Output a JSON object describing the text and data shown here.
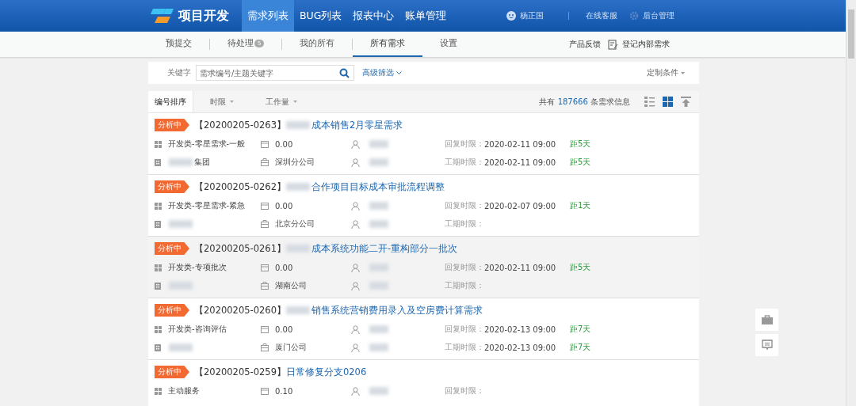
{
  "header": {
    "logo_text": "项目开发",
    "nav": [
      {
        "label": "需求列表",
        "selected": true
      },
      {
        "label": "BUG列表",
        "selected": false
      },
      {
        "label": "报表中心",
        "selected": false
      },
      {
        "label": "账单管理",
        "selected": false
      }
    ],
    "user": "杨正国",
    "links": [
      "在线客服",
      "后台管理"
    ]
  },
  "subnav": {
    "tabs": [
      {
        "label": "预提交",
        "selected": false
      },
      {
        "label": "待处理",
        "badge": "5",
        "selected": false
      },
      {
        "label": "我的所有",
        "selected": false
      },
      {
        "label": "所有需求",
        "selected": true
      },
      {
        "label": "设置",
        "selected": false
      }
    ],
    "feedback": "产品反馈",
    "register": "登记内部需求"
  },
  "filter": {
    "label": "关键字",
    "placeholder": "需求编号/主题关键字",
    "advanced": "高级筛选",
    "custom": "定制条件"
  },
  "sortbar": {
    "sorts": [
      {
        "label": "编号排序",
        "selected": true,
        "caret": false
      },
      {
        "label": "时限",
        "selected": false,
        "caret": true
      },
      {
        "label": "工作量",
        "selected": false,
        "caret": true
      }
    ],
    "total_prefix": "共有",
    "total": "187666",
    "total_suffix": "条需求信息"
  },
  "rows": [
    {
      "status": "分析中",
      "code": "【20200205-0263】",
      "title": "成本销售2月零星需求",
      "category": "开发类-零星需求-一般",
      "workload": "0.00",
      "org": "集团",
      "branch": "深圳分公司",
      "reply_label": "回复时限：",
      "reply_time": "2020-02-11 09:00",
      "reply_left": "距5天",
      "period_label": "工期时限：",
      "period_time": "2020-02-11 09:00",
      "period_left": "距5天",
      "selected": false
    },
    {
      "status": "分析中",
      "code": "【20200205-0262】",
      "title": "合作项目目标成本审批流程调整",
      "category": "开发类-零星需求-紧急",
      "workload": "0.00",
      "branch": "北京分公司",
      "reply_label": "回复时限：",
      "reply_time": "2020-02-07 09:00",
      "reply_left": "距1天",
      "period_label": "工期时限：",
      "selected": false
    },
    {
      "status": "分析中",
      "code": "【20200205-0261】",
      "title": "成本系统功能二开-重构部分一批次",
      "category": "开发类-专项批次",
      "workload": "0.00",
      "branch": "湖南公司",
      "reply_label": "回复时限：",
      "reply_time": "2020-02-11 09:00",
      "reply_left": "距5天",
      "period_label": "工期时限：",
      "selected": true
    },
    {
      "status": "分析中",
      "code": "【20200205-0260】",
      "title": "销售系统营销费用录入及空房费计算需求",
      "category": "开发类-咨询评估",
      "workload": "0.00",
      "branch": "厦门公司",
      "reply_label": "回复时限：",
      "reply_time": "2020-02-13 09:00",
      "reply_left": "距7天",
      "period_label": "工期时限：",
      "period_time": "2020-02-13 09:00",
      "period_left": "距7天",
      "selected": false
    },
    {
      "status": "分析中",
      "code": "【20200205-0259】",
      "title": "日常修复分支0206",
      "category": "主动服务",
      "workload": "0.10",
      "reply_label": "回复时限：",
      "selected": false
    }
  ]
}
